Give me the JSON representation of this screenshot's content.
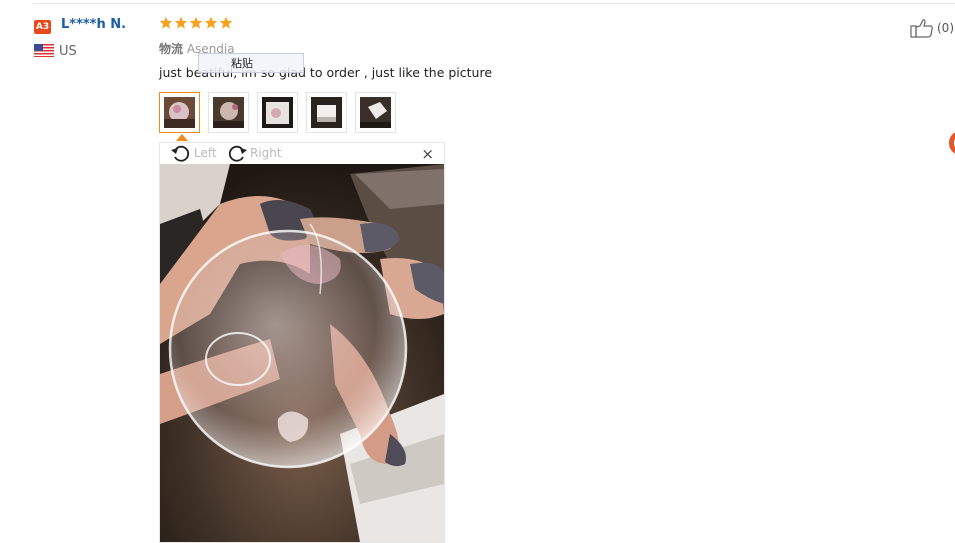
{
  "review": {
    "level_badge": "A3",
    "user_name": "L****h N.",
    "country": "US",
    "rating": 5,
    "logistics_label": "物流",
    "logistics_value": "Asendia",
    "text": "just beatiful, im so glad to order , just like the picture",
    "like_count": "(0)"
  },
  "tooltip": {
    "label": "粘贴"
  },
  "thumbnails": [
    {
      "name": "photo-1",
      "active": true
    },
    {
      "name": "photo-2",
      "active": false
    },
    {
      "name": "photo-3",
      "active": false
    },
    {
      "name": "photo-4",
      "active": false
    },
    {
      "name": "photo-5",
      "active": false
    }
  ],
  "viewer": {
    "rotate_left_label": "Left",
    "rotate_right_label": "Right",
    "close_symbol": "×"
  },
  "icons": {
    "star": "star-icon",
    "like": "thumbs-up-icon",
    "rotate_left": "rotate-left-icon",
    "rotate_right": "rotate-right-icon",
    "close": "close-icon",
    "flag": "us-flag-icon"
  },
  "colors": {
    "star": "#f7a21d",
    "username": "#1a5ea8",
    "badge": "#e8481a",
    "active_thumb": "#f08c1f"
  }
}
